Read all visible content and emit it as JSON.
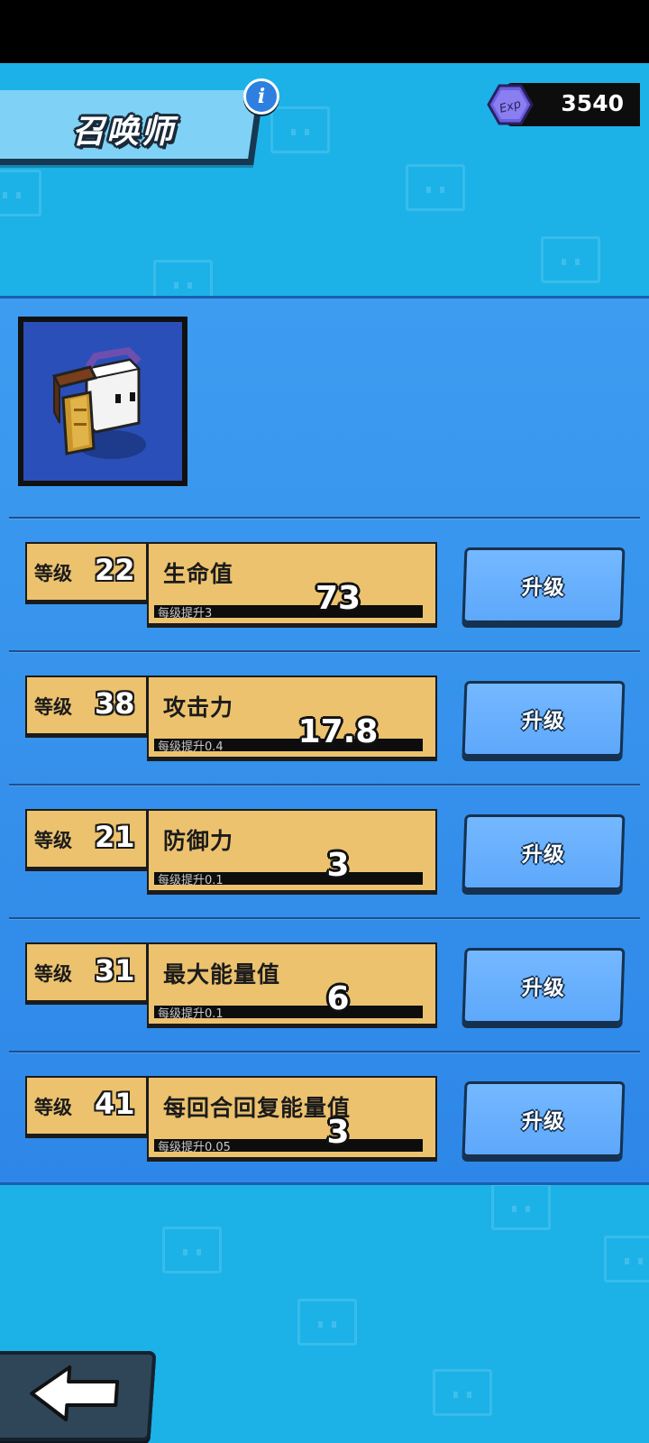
{
  "header": {
    "title": "召唤师",
    "exp_icon_label": "Exp",
    "exp_value": "3540",
    "info_label": "i"
  },
  "stats": [
    {
      "level_label": "等级",
      "level": "22",
      "name": "生命值",
      "increment": "每级提升3",
      "value": "73",
      "button": "升级"
    },
    {
      "level_label": "等级",
      "level": "38",
      "name": "攻击力",
      "increment": "每级提升0.4",
      "value": "17.8",
      "button": "升级"
    },
    {
      "level_label": "等级",
      "level": "21",
      "name": "防御力",
      "increment": "每级提升0.1",
      "value": "3",
      "button": "升级"
    },
    {
      "level_label": "等级",
      "level": "31",
      "name": "最大能量值",
      "increment": "每级提升0.1",
      "value": "6",
      "button": "升级"
    },
    {
      "level_label": "等级",
      "level": "41",
      "name": "每回合回复能量值",
      "increment": "每级提升0.05",
      "value": "3",
      "button": "升级"
    }
  ],
  "colors": {
    "background": "#1cb2e8",
    "panel": "#3d9cf0",
    "stat_box": "#ecc26e",
    "button": "#6cb2ff",
    "exp_gem": "#6b5fe0"
  }
}
